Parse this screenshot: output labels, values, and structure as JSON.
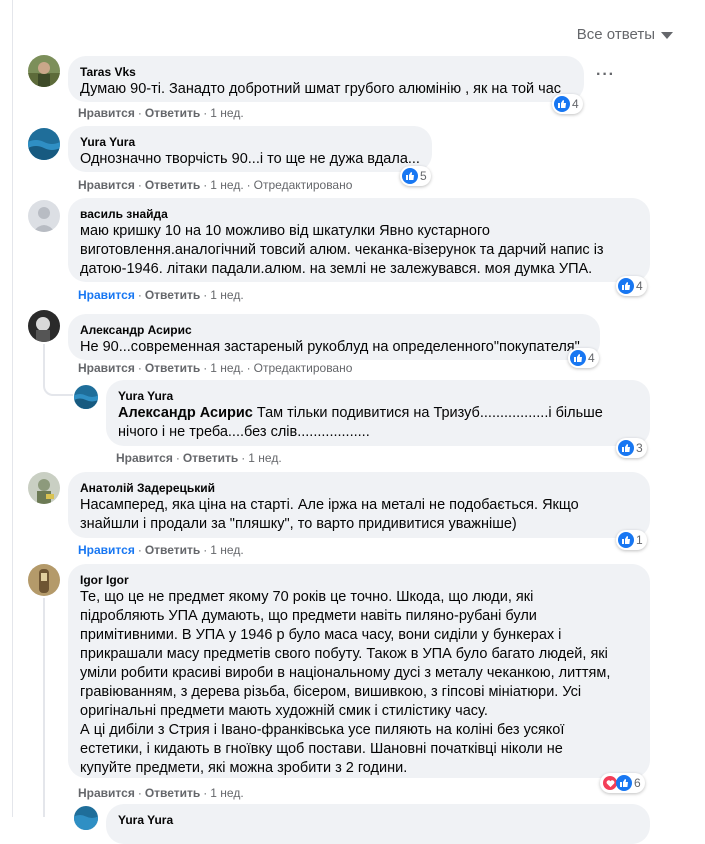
{
  "sort_label": "Все ответы",
  "actions": {
    "like": "Нравится",
    "reply": "Ответить"
  },
  "comments": [
    {
      "author": "Taras Vks",
      "text": "Думаю 90-ті. Занадто добротний шмат грубого алюмінію , як на той час",
      "time": "1 нед.",
      "edited": "",
      "reactions": "4"
    },
    {
      "author": "Yura Yura",
      "text": "Однозначно творчість 90...і то ще не дужа вдала...",
      "time": "1 нед.",
      "edited": "Отредактировано",
      "reactions": "5"
    },
    {
      "author": "василь знайда",
      "text": "маю кришку 10 на 10 можливо від шкатулки Явно кустарного\nвиготовлення.аналогічний товсий алюм. чеканка-візерунок та дарчий напис із\nдатою-1946. літаки падали.алюм. на землі не залежувався. моя думка УПА.",
      "time": "1 нед.",
      "edited": "",
      "reactions": "4"
    },
    {
      "author": "Александр Асирис",
      "text": "Не 90...современная застареный рукоблуд на определенного\"покупателя\"",
      "time": "1 нед.",
      "edited": "Отредактировано",
      "reactions": "4"
    },
    {
      "author": "Yura Yura",
      "mention": "Александр Асирис",
      "text": " Там тільки подивитися на Тризуб.................і більше\nнічого і не треба....без слів..................",
      "time": "1 нед.",
      "edited": "",
      "reactions": "3"
    },
    {
      "author": "Анатолій Задерецький",
      "text": "Насамперед, яка ціна на старті. Але іржа на металі не подобається. Якщо\nзнайшли і продали за \"пляшку\", то варто придивитися уважніше)",
      "time": "1 нед.",
      "edited": "",
      "reactions": "1"
    },
    {
      "author": "Igor Igor",
      "text": "Те, що це не предмет якому 70 років це точно. Шкода, що люди, які\nпідробляють УПА думають, що предмети навіть пиляно-рубані були\nпримітивними. В УПА у 1946 р було маса часу, вони сиділи у бункерах і\nприкрашали масу предметів свого побуту. Також в УПА було багато людей, які\nуміли робити красиві вироби в національному дусі з металу чеканкою, литтям,\nгравіюванням, з дерева різьба, бісером, вишивкою, з гіпсові мініатюри. Усі\nоригінальні предмети мають художній смик і стилістику часу.\nА ці дибіли з Стрия і Івано-франківська усе пиляють на коліні без усякої\nестетики, і кидають в гноївку щоб постави. Шановні початківці ніколи не\nкупуйте предмети, які можна зробити з 2 години.",
      "time": "1 нед.",
      "edited": "",
      "reactions": "6"
    },
    {
      "author": "Yura Yura"
    }
  ]
}
